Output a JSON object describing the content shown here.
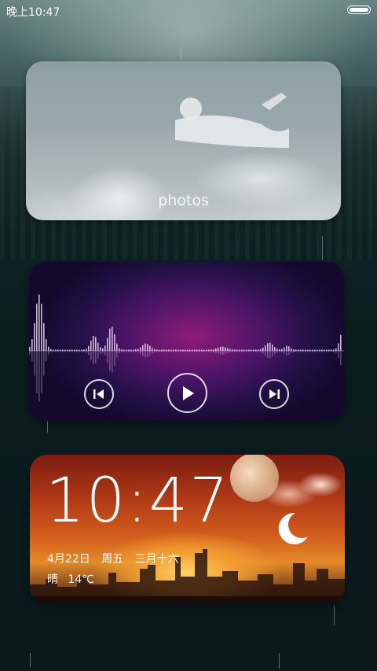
{
  "status_bar": {
    "time": "晚上10:47",
    "battery_level": 1.0
  },
  "photos_widget": {
    "label": "photos"
  },
  "music_widget": {
    "controls": [
      "previous",
      "play",
      "next"
    ],
    "accent_color": "#8e1c78"
  },
  "clock_widget": {
    "time": "10:47",
    "date": "4月22日",
    "weekday": "周五",
    "lunar_date": "三月十六",
    "weather": "晴",
    "temperature": "14℃"
  }
}
